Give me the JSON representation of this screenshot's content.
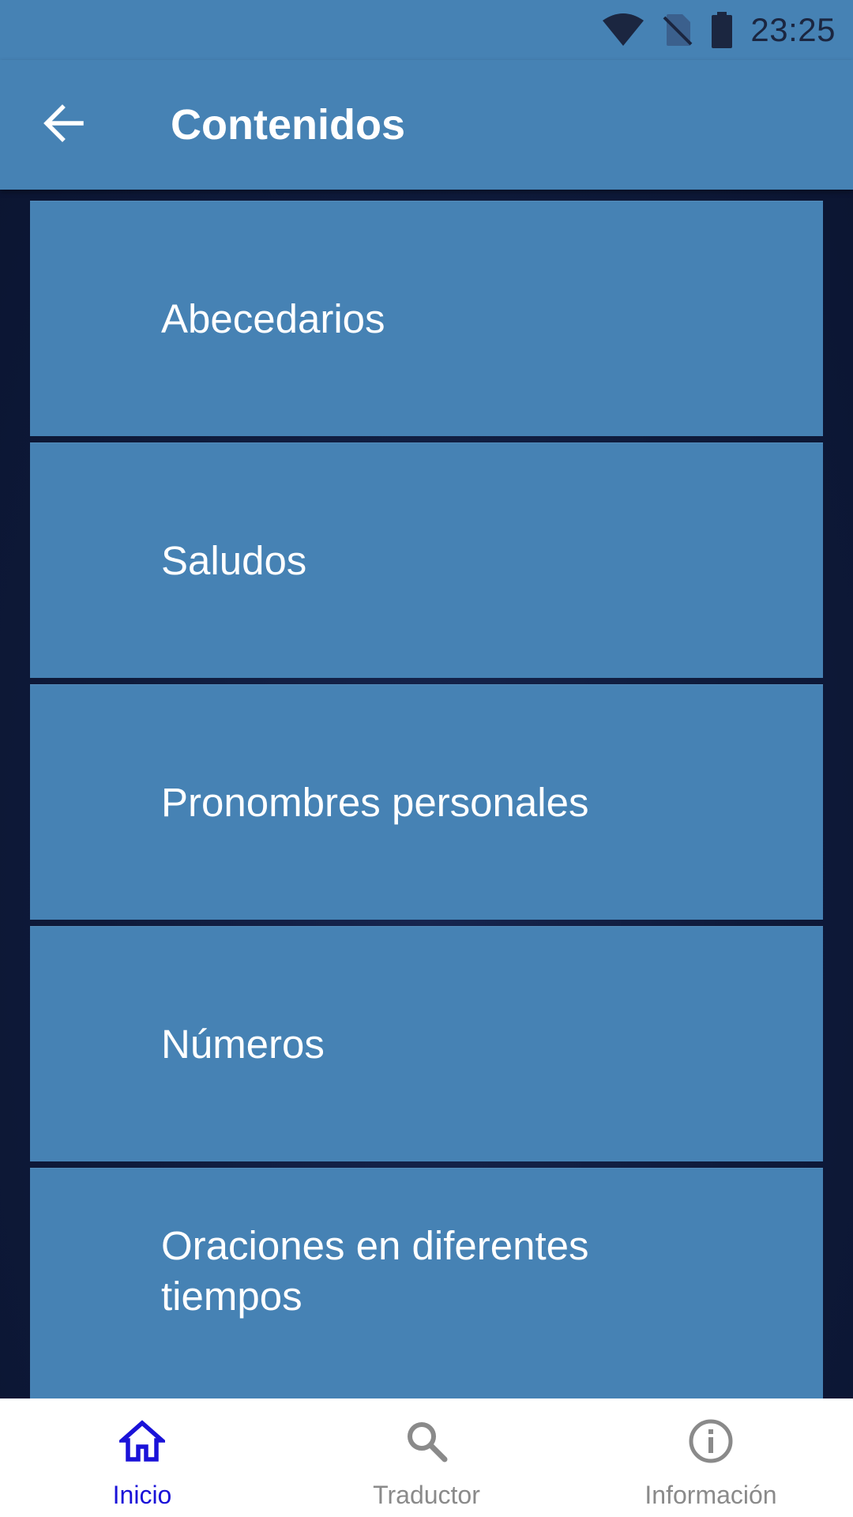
{
  "status_bar": {
    "time": "23:25",
    "icons": [
      "wifi-icon",
      "no-sim-icon",
      "battery-icon"
    ]
  },
  "app_bar": {
    "back_icon": "arrow-back-icon",
    "title": "Contenidos"
  },
  "list": {
    "items": [
      {
        "label": "Abecedarios"
      },
      {
        "label": "Saludos"
      },
      {
        "label": "Pronombres personales"
      },
      {
        "label": "Números"
      },
      {
        "label": "Oraciones en diferentes tiempos"
      }
    ]
  },
  "bottom_nav": {
    "items": [
      {
        "label": "Inicio",
        "icon": "home-icon",
        "active": true
      },
      {
        "label": "Traductor",
        "icon": "search-icon",
        "active": false
      },
      {
        "label": "Información",
        "icon": "info-icon",
        "active": false
      }
    ]
  },
  "colors": {
    "primary": "#4682b4",
    "background": "#0e1a3a",
    "active_nav": "#1a12d8",
    "inactive_nav": "#8a8a8a"
  }
}
